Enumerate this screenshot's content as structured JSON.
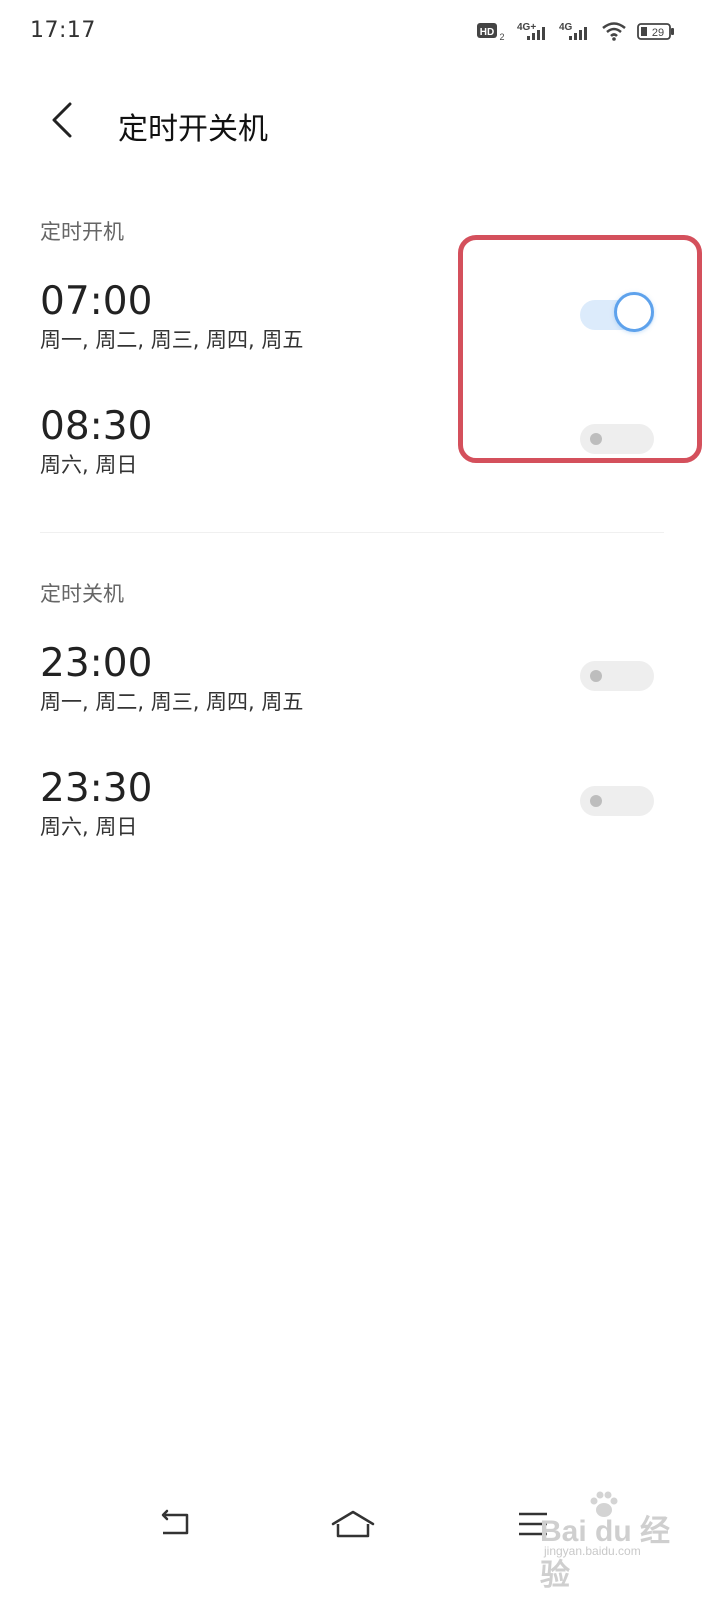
{
  "status_bar": {
    "time": "17:17",
    "icons": [
      "hd-icon",
      "signal-4g-plus-icon",
      "signal-4g-icon",
      "wifi-icon",
      "battery-icon"
    ],
    "hd_label": "HD",
    "hd_sub": "2",
    "net1_label": "4G+",
    "net2_label": "4G",
    "battery_level": "29"
  },
  "header": {
    "title": "定时开关机",
    "back_icon": "chevron-left-icon"
  },
  "sections": [
    {
      "label": "定时开机",
      "items": [
        {
          "time": "07:00",
          "days": "周一, 周二, 周三, 周四, 周五",
          "enabled": true
        },
        {
          "time": "08:30",
          "days": "周六, 周日",
          "enabled": false
        }
      ]
    },
    {
      "label": "定时关机",
      "items": [
        {
          "time": "23:00",
          "days": "周一, 周二, 周三, 周四, 周五",
          "enabled": false
        },
        {
          "time": "23:30",
          "days": "周六, 周日",
          "enabled": false
        }
      ]
    }
  ],
  "nav_bar": {
    "icons": [
      "back-nav-icon",
      "home-nav-icon",
      "menu-nav-icon"
    ]
  },
  "watermark": {
    "main": "Bai du 经验",
    "sub": "jingyan.baidu.com"
  },
  "colors": {
    "toggle_on_track": "#dcebfb",
    "toggle_on_knob_border": "#5ea2ec",
    "toggle_off_track": "#eeeeee",
    "highlight": "#d4505c"
  }
}
